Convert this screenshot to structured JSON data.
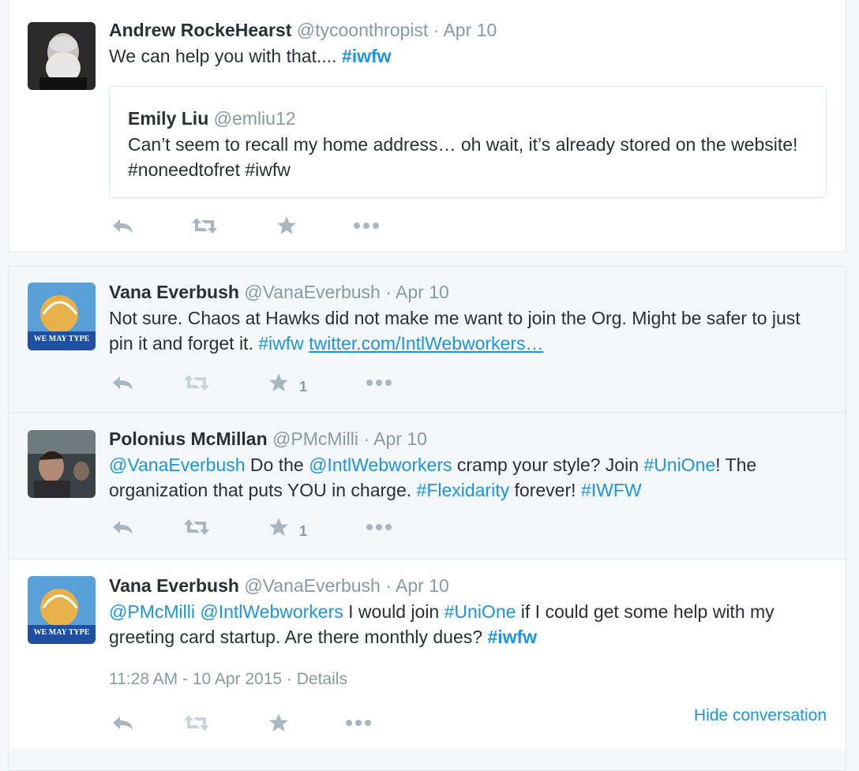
{
  "tweets": [
    {
      "name": "Andrew RockeHearst",
      "handle": "@tycoonthropist",
      "date": "· Apr 10",
      "text_pre": "We can help you with that.... ",
      "tag1": "#iwfw",
      "quote": {
        "name": "Emily Liu",
        "handle": "@emliu12",
        "text": "Can’t seem to recall my home address… oh wait, it’s already stored on the website! #noneedtofret #iwfw"
      }
    },
    {
      "name": "Vana Everbush",
      "handle": "@VanaEverbush",
      "date": "· Apr 10",
      "text_pre": "Not sure. Chaos at Hawks did not make me want to join the Org. Might be safer to just pin it and forget it.  ",
      "tag1": "#iwfw",
      "link": "twitter.com/IntlWebworkers…",
      "favorite_count": "1",
      "avatar_text": "WE MAY TYPE"
    },
    {
      "name": "Polonius McMillan",
      "handle": "@PMcMilli",
      "date": "· Apr 10",
      "mention1": "@VanaEverbush",
      "t1": " Do the ",
      "mention2": "@IntlWebworkers",
      "t2": " cramp your style? Join ",
      "tag1": "#UniOne",
      "t3": "! The organization that puts YOU in charge. ",
      "tag2": "#Flexidarity",
      "t4": " forever! ",
      "tag3": "#IWFW",
      "favorite_count": "1"
    },
    {
      "name": "Vana Everbush",
      "handle": "@VanaEverbush",
      "date": "· Apr 10",
      "mention1": "@PMcMilli",
      "mention2": "@IntlWebworkers",
      "t1": " I would join ",
      "tag1": "#UniOne",
      "t2": " if I could get some help with my greeting card startup. Are there monthly dues? ",
      "tag2": "#iwfw",
      "timestamp": "11:28 AM - 10 Apr 2015 · Details",
      "hide_conversation": "Hide conversation",
      "avatar_text": "WE MAY TYPE"
    }
  ],
  "colors": {
    "accent": "#1b95e0",
    "muted": "#8899a6",
    "icon": "#a8b6c2"
  }
}
